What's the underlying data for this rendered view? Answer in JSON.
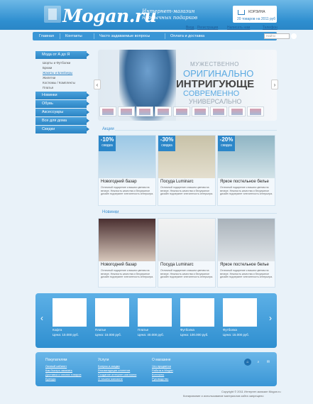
{
  "header": {
    "logo": "Mogan.ru",
    "tagline": "Интернет-магазин необычных подарков",
    "cart_label": "КОРЗИНА",
    "cart_summary": "20 товаров на 2011 руб",
    "links": [
      "Вход",
      "Регистрация",
      "Написать нам",
      "Телефон"
    ]
  },
  "menu": {
    "items": [
      "Главная",
      "Контакты",
      "Часто задаваемые вопросы",
      "Оплата и доставка"
    ],
    "search_placeholder": "Найти"
  },
  "sidebar": {
    "header": "Мода от А до Я",
    "subitems": [
      "Шорты и Футболки",
      "Брюки",
      "Жакеты и Блейзеры",
      "Жилетки",
      "Костюмы / Комплекты",
      "Платья"
    ],
    "categories": [
      "Новинки",
      "Обувь",
      "Аксессуары",
      "Все для дома",
      "Скидки"
    ]
  },
  "banner": {
    "lines": [
      "МУЖЕСТВЕННО",
      "ОРИГИНАЛЬНО",
      "ИНТРИГУЮЩЕ",
      "СОВРЕМЕННО",
      "УНИВЕРСАЛЬНО"
    ]
  },
  "promo": {
    "title": "Акции",
    "cards": [
      {
        "name": "Новогодний базар",
        "discount": "-10%",
        "discount_label": "скидка",
        "desc": "Отличный подарение к вашим цветам на вечере. Нежность качества и бесуприное дизайн подчеркнет элегантность интерьера."
      },
      {
        "name": "Посуда Luminarc",
        "discount": "-30%",
        "discount_label": "скидка",
        "desc": "Отличный подарение к вашим цветам на вечере. Нежность качества и бесуприное дизайн подчеркнет элегантность интерьера."
      },
      {
        "name": "Яркое постельное белье",
        "discount": "-20%",
        "discount_label": "скидка",
        "desc": "Отличный подарение к вашим цветам на вечере. Нежность качества и бесуприное дизайн подчеркнет элегантность интерьера."
      }
    ]
  },
  "news": {
    "title": "Новинки",
    "cards": [
      {
        "name": "Новогодний базар",
        "desc": "Отличный подарение к вашим цветам на вечере. Нежность качества и бесуприное дизайн подчеркнет элегантность интерьера."
      },
      {
        "name": "Посуда Luminarc",
        "desc": "Отличный подарение к вашим цветам на вечере. Нежность качества и бесуприное дизайн подчеркнет элегантность интерьера."
      },
      {
        "name": "Яркое постельное белье",
        "desc": "Отличный подарение к вашим цветам на вечере. Нежность качества и бесуприное дизайн подчеркнет элегантность интерьера."
      }
    ]
  },
  "carousel": {
    "items": [
      {
        "name": "Кофта",
        "price": "Цена: 10.000 руб."
      },
      {
        "name": "Платье",
        "price": "Цена: 15.000 руб."
      },
      {
        "name": "Платье",
        "price": "Цена: 40.000 руб."
      },
      {
        "name": "Футболка",
        "price": "Цена: 100.000 руб."
      },
      {
        "name": "Футболка",
        "price": "Цена: 15.000 руб."
      }
    ]
  },
  "footer": {
    "columns": [
      {
        "title": "Покупателям",
        "links": [
          "Личный кабинет",
          "Как быстро заказать",
          "Доставка и оплата товаров",
          "Бренды"
        ]
      },
      {
        "title": "Услуги",
        "links": [
          "Бонусы и скидки",
          "Рекомендации клиентов",
          "Создание интернет-магазина",
          "О нашем магазине"
        ]
      },
      {
        "title": "О магазине",
        "links": [
          "Что продается",
          "Работа в Mogan",
          "Контакты",
          "Руководство"
        ]
      }
    ],
    "copyright": "Copyright © 2011 Интернет-магазин Mogan.ru",
    "note": "Копирование и использование материалов сайта запрещено"
  },
  "colors": {
    "accent": "#2f8fd0",
    "background": "#e9f2f9"
  }
}
